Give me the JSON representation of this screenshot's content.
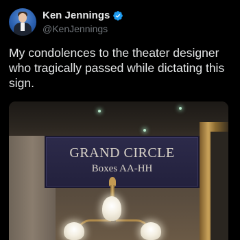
{
  "tweet": {
    "author": {
      "display_name": "Ken Jennings",
      "handle": "@KenJennings",
      "verified": true
    },
    "text": "My condolences to the theater designer who tragically passed while dictating this sign.",
    "photo": {
      "sign_title": "GRAND CIRCLE",
      "sign_subtitle": "Boxes AA-HH"
    }
  },
  "colors": {
    "background": "#000000",
    "text": "#e7e9ea",
    "handle": "#71767b",
    "verified": "#1d9bf0"
  },
  "icons": {
    "verified": "verified-badge-icon"
  }
}
